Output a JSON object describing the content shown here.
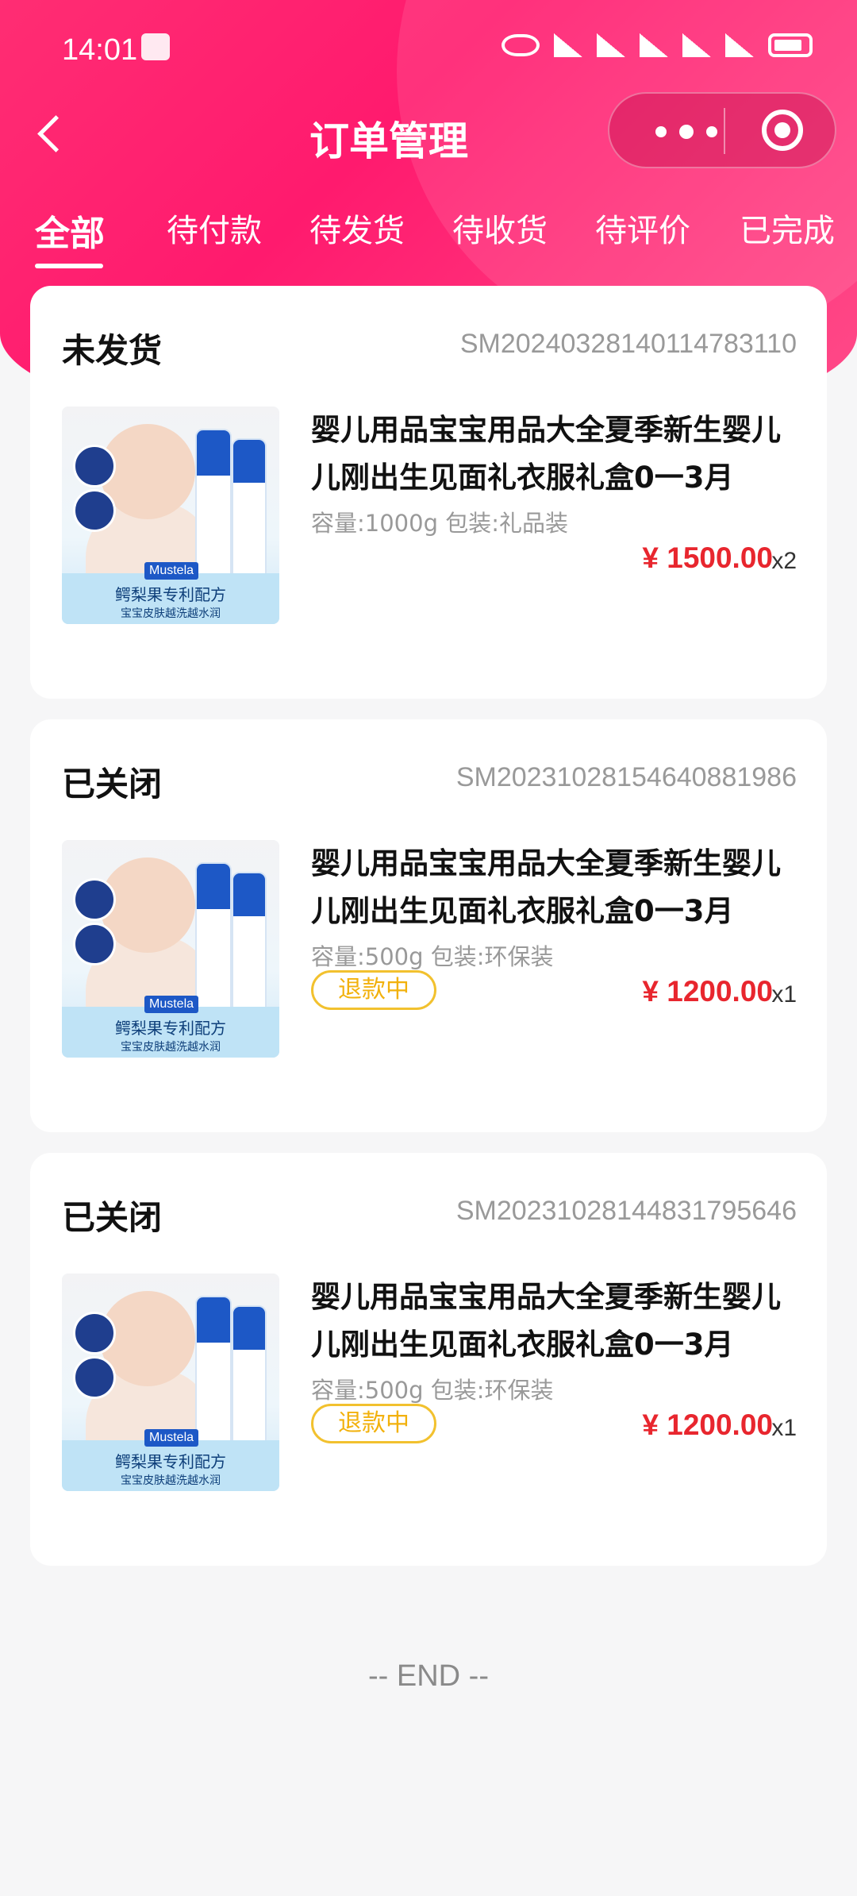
{
  "status_bar": {
    "time": "14:01"
  },
  "header": {
    "title": "订单管理"
  },
  "tabs": [
    {
      "label": "全部",
      "active": true
    },
    {
      "label": "待付款",
      "active": false
    },
    {
      "label": "待发货",
      "active": false
    },
    {
      "label": "待收货",
      "active": false
    },
    {
      "label": "待评价",
      "active": false
    },
    {
      "label": "已完成",
      "active": false
    }
  ],
  "orders": [
    {
      "status": "未发货",
      "order_no": "SM20240328140114783110",
      "product_title": "婴儿用品宝宝用品大全夏季新生婴儿儿刚出生见面礼衣服礼盒0一3月",
      "spec": "容量:1000g 包装:礼品装",
      "price": "¥ 1500.00",
      "qty": "x2",
      "image_caption": "鳄梨果专利配方",
      "image_subcaption": "宝宝皮肤越洗越水润",
      "image_brand": "Mustela"
    },
    {
      "status": "已关闭",
      "order_no": "SM20231028154640881986",
      "product_title": "婴儿用品宝宝用品大全夏季新生婴儿儿刚出生见面礼衣服礼盒0一3月",
      "spec": "容量:500g 包装:环保装",
      "refund_label": "退款中",
      "price": "¥ 1200.00",
      "qty": "x1",
      "image_caption": "鳄梨果专利配方",
      "image_subcaption": "宝宝皮肤越洗越水润",
      "image_brand": "Mustela"
    },
    {
      "status": "已关闭",
      "order_no": "SM20231028144831795646",
      "product_title": "婴儿用品宝宝用品大全夏季新生婴儿儿刚出生见面礼衣服礼盒0一3月",
      "spec": "容量:500g 包装:环保装",
      "refund_label": "退款中",
      "price": "¥ 1200.00",
      "qty": "x1",
      "image_caption": "鳄梨果专利配方",
      "image_subcaption": "宝宝皮肤越洗越水润",
      "image_brand": "Mustela"
    }
  ],
  "footer": {
    "end_text": "-- END --"
  },
  "colors": {
    "accent": "#ff1a6e",
    "price": "#e8262e",
    "refund": "#f2b10c"
  }
}
